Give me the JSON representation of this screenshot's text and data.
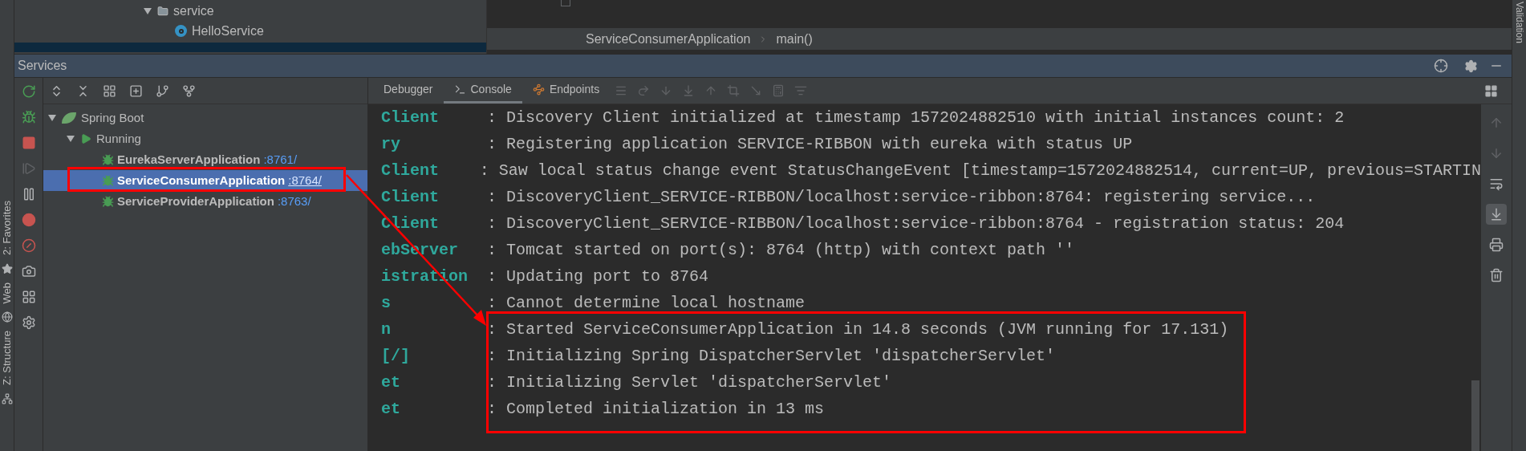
{
  "project_tree": {
    "label": "service",
    "expanded": true,
    "children": [
      {
        "label": "HelloService"
      }
    ]
  },
  "editor": {
    "breadcrumb": [
      "ServiceConsumerApplication",
      "main()"
    ]
  },
  "right_stripe": {
    "label": "Validation"
  },
  "left_stripe": [
    {
      "kind": "favorites",
      "label": "2: Favorites"
    },
    {
      "kind": "web",
      "label": "Web"
    },
    {
      "kind": "structure",
      "label": "Z: Structure"
    }
  ],
  "services": {
    "title": "Services",
    "actions": [
      {
        "kind": "rerun",
        "disabled": false
      },
      {
        "kind": "debug",
        "disabled": false
      },
      {
        "kind": "stop",
        "disabled": false
      },
      {
        "kind": "resume",
        "disabled": true
      },
      {
        "kind": "pause",
        "disabled": false
      },
      {
        "kind": "breakpoints",
        "disabled": false
      },
      {
        "kind": "mute",
        "disabled": false
      },
      {
        "kind": "camera",
        "disabled": false
      },
      {
        "kind": "layout",
        "disabled": false
      },
      {
        "kind": "settings",
        "disabled": false
      }
    ],
    "tree_toolbar": [
      {
        "kind": "expand"
      },
      {
        "kind": "collapse"
      },
      {
        "kind": "group"
      },
      {
        "kind": "add"
      },
      {
        "kind": "tree"
      },
      {
        "kind": "split"
      }
    ],
    "tree": {
      "label": "Spring Boot",
      "expanded": true,
      "children": [
        {
          "label": "Running",
          "expanded": true,
          "children": [
            {
              "name": "EurekaServerApplication",
              "port": ":8761/",
              "selected": false
            },
            {
              "name": "ServiceConsumerApplication",
              "port": ":8764/",
              "selected": true
            },
            {
              "name": "ServiceProviderApplication",
              "port": ":8763/",
              "selected": false
            }
          ]
        }
      ]
    },
    "tabs": [
      {
        "label": "Debugger",
        "kind": "none",
        "selected": false
      },
      {
        "label": "Console",
        "kind": "console",
        "selected": true
      },
      {
        "label": "Endpoints",
        "kind": "endpoints",
        "selected": false
      }
    ],
    "console_toolbar": [
      {
        "kind": "menu"
      },
      {
        "kind": "step-over"
      },
      {
        "kind": "step-into"
      },
      {
        "kind": "force-step"
      },
      {
        "kind": "step-out"
      },
      {
        "kind": "drop-frame"
      },
      {
        "kind": "run-to-cursor"
      },
      {
        "kind": "evaluate"
      },
      {
        "kind": "trace"
      }
    ],
    "console": [
      {
        "source": "Client",
        "message": ": Discovery Client initialized at timestamp 1572024882510 with initial instances count: 2"
      },
      {
        "source": "ry",
        "message": ": Registering application SERVICE-RIBBON with eureka with status UP"
      },
      {
        "source": "Client",
        "message": ": Saw local status change event StatusChangeEvent [timestamp=1572024882514, current=UP, previous=STARTIN"
      },
      {
        "source": "Client",
        "message": ": DiscoveryClient_SERVICE-RIBBON/localhost:service-ribbon:8764: registering service..."
      },
      {
        "source": "Client",
        "message": ": DiscoveryClient_SERVICE-RIBBON/localhost:service-ribbon:8764 - registration status: 204"
      },
      {
        "source": "ebServer",
        "message": ": Tomcat started on port(s): 8764 (http) with context path ''"
      },
      {
        "source": "istration",
        "message": ": Updating port to 8764"
      },
      {
        "source": "s",
        "message": ": Cannot determine local hostname"
      },
      {
        "source": "n",
        "message": ": Started ServiceConsumerApplication in 14.8 seconds (JVM running for 17.131)"
      },
      {
        "source": "[/]",
        "message": ": Initializing Spring DispatcherServlet 'dispatcherServlet'"
      },
      {
        "source": "et",
        "message": ": Initializing Servlet 'dispatcherServlet'"
      },
      {
        "source": "et",
        "message": ": Completed initialization in 13 ms"
      }
    ],
    "console_actions": [
      {
        "kind": "up",
        "disabled": true,
        "selected": false
      },
      {
        "kind": "down",
        "disabled": true,
        "selected": false
      },
      {
        "kind": "wrap",
        "disabled": false,
        "selected": false
      },
      {
        "kind": "scroll-end",
        "disabled": false,
        "selected": true
      },
      {
        "kind": "print",
        "disabled": false,
        "selected": false
      },
      {
        "kind": "trash",
        "disabled": false,
        "selected": false
      }
    ]
  }
}
